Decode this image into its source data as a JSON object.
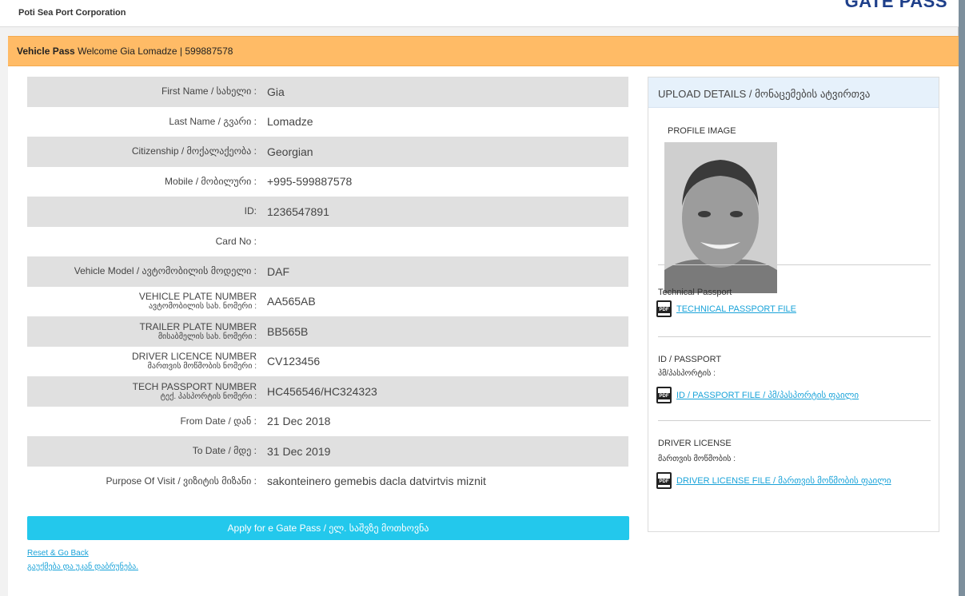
{
  "header": {
    "corporation": "Poti Sea Port Corporation",
    "brand": "GATE PASS"
  },
  "banner": {
    "title": "Vehicle Pass",
    "welcome": "Welcome Gia Lomadze | 599887578"
  },
  "details": [
    {
      "label": "First Name / სახელი :",
      "sub": "",
      "value": "Gia"
    },
    {
      "label": "Last Name / გვარი :",
      "sub": "",
      "value": "Lomadze"
    },
    {
      "label": "Citizenship / მოქალაქეობა :",
      "sub": "",
      "value": "Georgian"
    },
    {
      "label": "Mobile / მობილური :",
      "sub": "",
      "value": "+995-599887578"
    },
    {
      "label": "ID:",
      "sub": "",
      "value": "1236547891"
    },
    {
      "label": "Card No :",
      "sub": "",
      "value": ""
    },
    {
      "label": "Vehicle Model / ავტომობილის მოდელი :",
      "sub": "",
      "value": "DAF"
    },
    {
      "label": "VEHICLE PLATE NUMBER",
      "sub": "ავტომობილის სახ. ნომერი :",
      "value": "AA565AB"
    },
    {
      "label": "TRAILER PLATE NUMBER",
      "sub": "მისაბმელის სახ. ნომერი :",
      "value": "BB565B"
    },
    {
      "label": "DRIVER LICENCE NUMBER",
      "sub": "მართვის მოწმობის ნომერი :",
      "value": "CV123456"
    },
    {
      "label": "TECH PASSPORT NUMBER",
      "sub": "ტექ. პასპორტის ნომერი :",
      "value": "HC456546/HC324323"
    },
    {
      "label": "From Date / დან :",
      "sub": "",
      "value": "21 Dec 2018"
    },
    {
      "label": "To Date / მდე :",
      "sub": "",
      "value": "31 Dec 2019"
    },
    {
      "label": "Purpose Of Visit / ვიზიტის მიზანი :",
      "sub": "",
      "value": "sakonteinero gemebis dacla datvirtvis miznit"
    }
  ],
  "actions": {
    "apply": "Apply for e Gate Pass / ელ. საშვზე მოთხოვნა",
    "reset_en": "Reset & Go Back",
    "reset_ka": "გაუქმება და უკან დაბრუნება."
  },
  "upload": {
    "title": "UPLOAD DETAILS / მონაცემების ატვირთვა",
    "profile_image": "PROFILE IMAGE",
    "tech_passport_label": "Technical Passport",
    "tech_passport_file": "TECHNICAL PASSPORT FILE",
    "id_label": "ID / PASSPORT",
    "id_sub": "პმ/პასპორტის :",
    "id_file": "ID / PASSPORT FILE / პმ/პასპორტის ფაილი",
    "driver_label": "DRIVER LICENSE",
    "driver_sub": "მართვის მოწმობის :",
    "driver_file": "DRIVER LICENSE FILE / მართვის მოწმობის ფაილი"
  }
}
